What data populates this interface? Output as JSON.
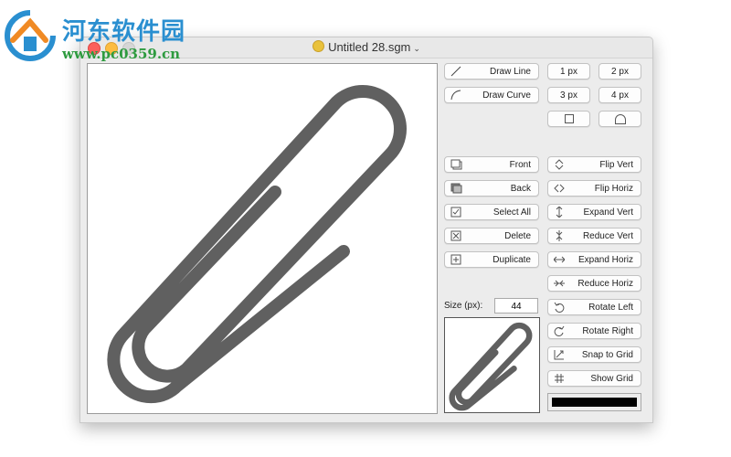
{
  "watermark": {
    "title": "河东软件园",
    "url": "www.pc0359.cn"
  },
  "window": {
    "title": "Untitled 28.sgm"
  },
  "tools": {
    "draw_line": "Draw Line",
    "draw_curve": "Draw Curve",
    "px1": "1 px",
    "px2": "2 px",
    "px3": "3 px",
    "px4": "4 px"
  },
  "arrange": {
    "front": "Front",
    "back": "Back",
    "select_all": "Select All",
    "delete": "Delete",
    "duplicate": "Duplicate"
  },
  "transform": {
    "flip_vert": "Flip Vert",
    "flip_horiz": "Flip Horiz",
    "expand_vert": "Expand Vert",
    "reduce_vert": "Reduce Vert",
    "expand_horiz": "Expand Horiz",
    "reduce_horiz": "Reduce Horiz",
    "rotate_left": "Rotate Left",
    "rotate_right": "Rotate Right",
    "snap_to_grid": "Snap to Grid",
    "show_grid": "Show Grid"
  },
  "size": {
    "label": "Size (px):",
    "value": "44"
  },
  "colors": {
    "stroke": "#606060",
    "fill_swatch": "#000000"
  }
}
